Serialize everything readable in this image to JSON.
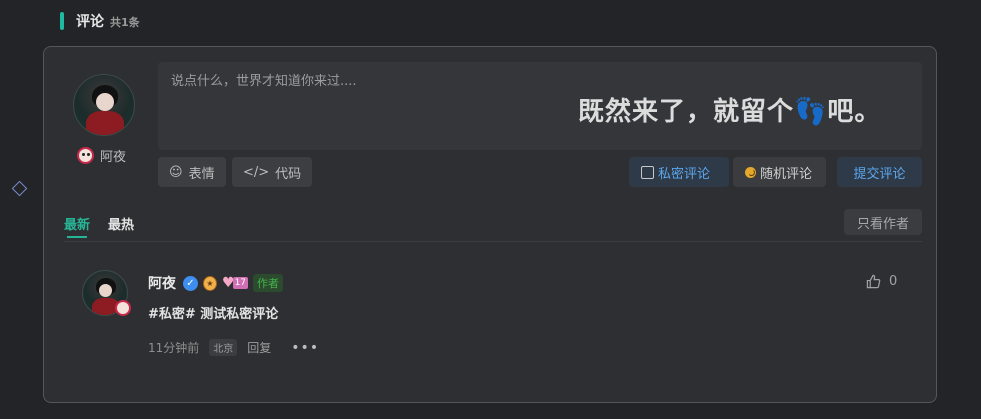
{
  "section": {
    "title": "评论",
    "count": "共1条"
  },
  "composer": {
    "user_name": "阿夜",
    "placeholder": "说点什么，世界才知道你来过....",
    "watermark": "既然来了，就留个👣吧。",
    "emoji_label": "表情",
    "code_label": "代码",
    "private_label": "私密评论",
    "random_label": "随机评论",
    "submit_label": "提交评论"
  },
  "tabs": [
    {
      "label": "最新",
      "active": true
    },
    {
      "label": "最热",
      "active": false
    }
  ],
  "author_only_label": "只看作者",
  "comments": [
    {
      "author": "阿夜",
      "level": "17",
      "author_tag": "作者",
      "content": "#私密# 测试私密评论",
      "time": "11分钟前",
      "location": "北京",
      "reply_label": "回复",
      "likes": "0"
    }
  ],
  "colors": {
    "accent": "#27b598",
    "link_blue": "#5ba7ee",
    "background": "#232427",
    "panel": "#2e2f32"
  },
  "icons": {
    "emoji": "smile-icon",
    "code": "code-icon",
    "like": "thumbs-up-icon",
    "more": "more-dots-icon",
    "verified": "verified-check-icon"
  }
}
